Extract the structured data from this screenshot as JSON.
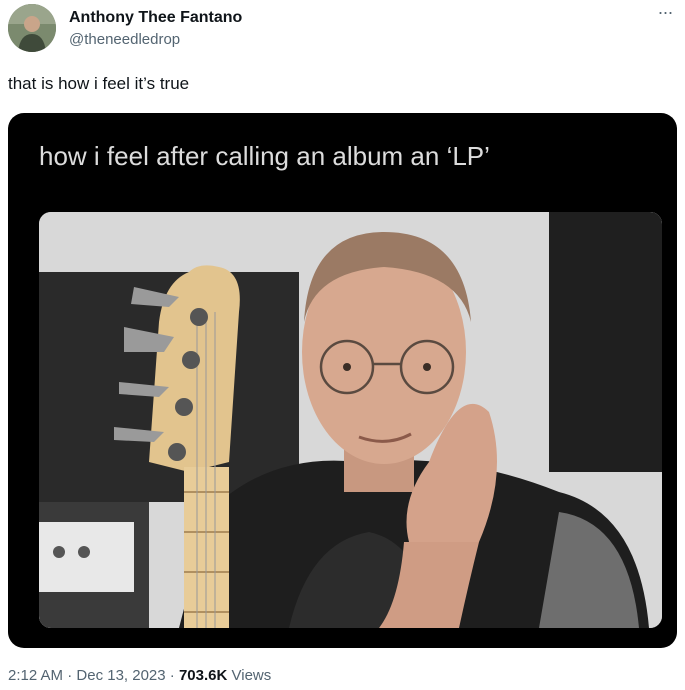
{
  "author": {
    "display_name": "Anthony Thee Fantano",
    "handle": "@theneedledrop",
    "avatar_icon": "profile-photo"
  },
  "more_icon": "more-horizontal-icon",
  "tweet": {
    "text": "that is how i feel it’s true"
  },
  "media": {
    "caption": "how i feel after calling an album an ‘LP’"
  },
  "meta": {
    "time": "2:12 AM",
    "separator1": " · ",
    "date": "Dec 13, 2023",
    "separator2": " · ",
    "views_count": "703.6K",
    "views_label": " Views"
  }
}
